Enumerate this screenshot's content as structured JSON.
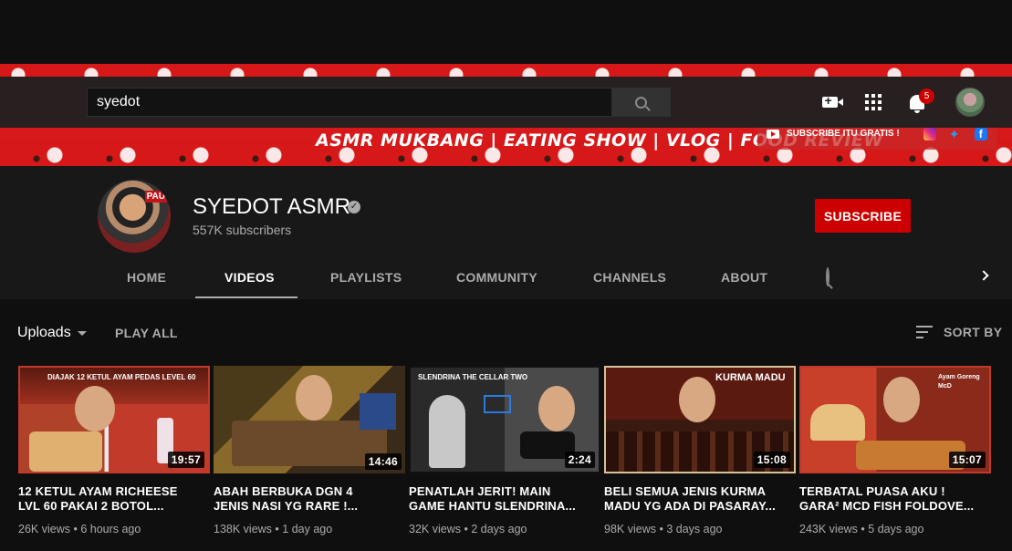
{
  "search": {
    "value": "syedot"
  },
  "notifications": {
    "count": "5"
  },
  "banner": {
    "tagline": "ASMR MUKBANG | EATING SHOW | VLOG | FOOD REVIEW",
    "promo": "SUBSCRIBE ITU GRATIS !"
  },
  "channel": {
    "name": "SYEDOT ASMR",
    "subscribers": "557K subscribers",
    "subscribe_label": "SUBSCRIBE"
  },
  "tabs": [
    "HOME",
    "VIDEOS",
    "PLAYLISTS",
    "COMMUNITY",
    "CHANNELS",
    "ABOUT"
  ],
  "toolbar": {
    "uploads_label": "Uploads",
    "play_all": "PLAY ALL",
    "sort_by": "SORT BY"
  },
  "videos": [
    {
      "title_line1": "12 KETUL AYAM RICHEESE",
      "title_line2": "LVL 60 PAKAI 2 BOTOL...",
      "duration": "19:57",
      "views": "26K views",
      "age": "6 hours ago",
      "thumb_caption": "DIAJAK 12 KETUL AYAM PEDAS LEVEL 60"
    },
    {
      "title_line1": "ABAH BERBUKA DGN 4",
      "title_line2": "JENIS NASI YG RARE !...",
      "duration": "14:46",
      "views": "138K views",
      "age": "1 day ago",
      "thumb_caption": ""
    },
    {
      "title_line1": "PENATLAH JERIT! MAIN",
      "title_line2": "GAME HANTU SLENDRINA...",
      "duration": "2:24",
      "views": "32K views",
      "age": "2 days ago",
      "thumb_caption": "SLENDRINA THE CELLAR TWO"
    },
    {
      "title_line1": "BELI SEMUA JENIS KURMA",
      "title_line2": "MADU YG ADA DI PASARAY...",
      "duration": "15:08",
      "views": "98K views",
      "age": "3 days ago",
      "thumb_caption": "KURMA MADU"
    },
    {
      "title_line1": "TERBATAL PUASA AKU !",
      "title_line2": "GARA² MCD FISH FOLDOVE...",
      "duration": "15:07",
      "views": "243K views",
      "age": "5 days ago",
      "thumb_caption": "Ayam Goreng McD"
    }
  ]
}
